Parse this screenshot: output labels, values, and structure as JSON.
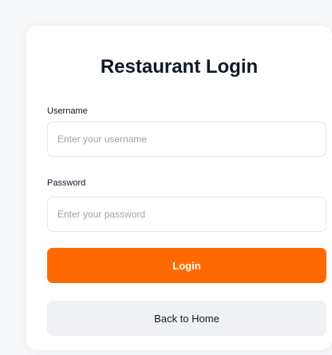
{
  "form": {
    "title": "Restaurant Login",
    "username": {
      "label": "Username",
      "placeholder": "Enter your username",
      "value": ""
    },
    "password": {
      "label": "Password",
      "placeholder": "Enter your password",
      "value": ""
    },
    "login_label": "Login",
    "back_label": "Back to Home"
  },
  "colors": {
    "primary": "#ff6a00",
    "secondary_button": "#f0f1f4",
    "text": "#111827",
    "placeholder": "#9ca3af",
    "border": "#e5e7eb"
  }
}
